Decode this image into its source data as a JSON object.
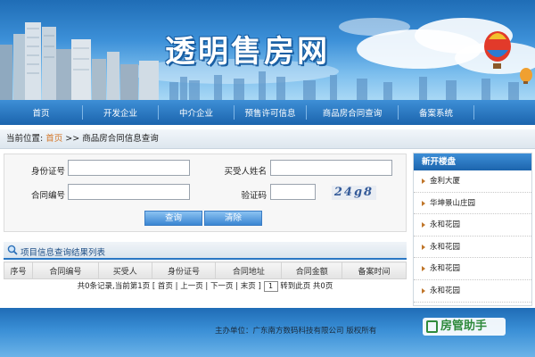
{
  "site": {
    "title": "透明售房网"
  },
  "nav": {
    "items": [
      "首页",
      "开发企业",
      "中介企业",
      "预售许可信息",
      "商品房合同查询",
      "备案系统"
    ]
  },
  "breadcrumb": {
    "prefix": "当前位置:",
    "home": "首页",
    "sep": " >> ",
    "current": "商品房合同信息查询"
  },
  "form": {
    "id_label": "身份证号",
    "id_value": "",
    "buyer_label": "买受人姓名",
    "buyer_value": "",
    "contract_label": "合同编号",
    "contract_value": "",
    "captcha_label": "验证码",
    "captcha_value": "",
    "captcha_text": "24g8",
    "search_button": "查询",
    "clear_button": "清除"
  },
  "results": {
    "title": "项目信息查询结果列表",
    "columns": [
      "序号",
      "合同编号",
      "买受人",
      "身份证号",
      "合同地址",
      "合同金额",
      "备案时间"
    ]
  },
  "pager": {
    "summary": "共0条记录,当前第1页 [",
    "first": "首页",
    "prev": "上一页",
    "next": "下一页",
    "last": "末页",
    "sep": " | ",
    "close": " ]",
    "page_value": "1",
    "goto": " 转到此页 共0页"
  },
  "sidebar": {
    "title": "新开楼盘",
    "items": [
      "金利大厦",
      "华坤景山庄园",
      "永和花园",
      "永和花园",
      "永和花园",
      "永和花园"
    ]
  },
  "footer": {
    "text": "主办单位：广东南方数码科技有限公司 版权所有"
  },
  "watermark": {
    "text": "房管助手"
  },
  "colors": {
    "nav": "#1b64ad",
    "accent": "#d4772a",
    "footer": "#3a8fd6"
  }
}
